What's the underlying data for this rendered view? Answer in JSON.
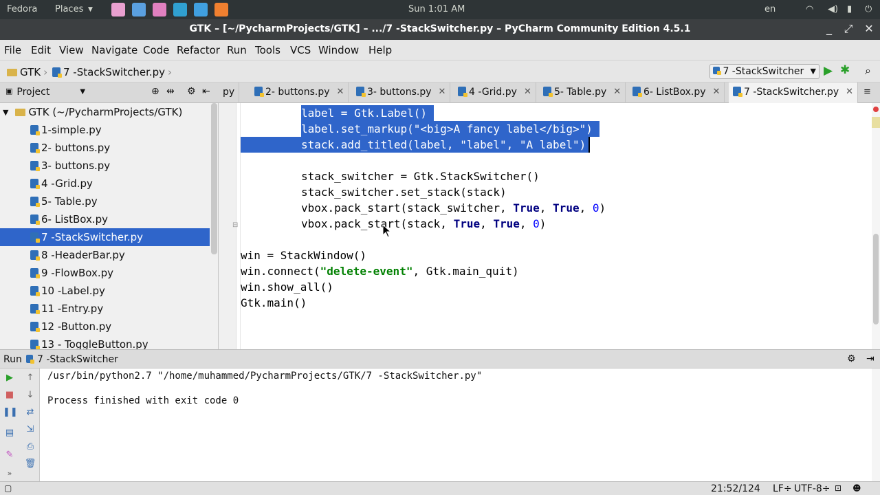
{
  "system": {
    "left": [
      "Fedora",
      "Places"
    ],
    "clock": "Sun 1:01 AM",
    "lang": "en"
  },
  "window": {
    "title": "GTK – [~/PycharmProjects/GTK] – .../7 -StackSwitcher.py – PyCharm Community Edition 4.5.1"
  },
  "menu": [
    "File",
    "Edit",
    "View",
    "Navigate",
    "Code",
    "Refactor",
    "Run",
    "Tools",
    "VCS",
    "Window",
    "Help"
  ],
  "breadcrumb": {
    "project": "GTK",
    "file": "7 -StackSwitcher.py"
  },
  "run_config": "7 -StackSwitcher",
  "project_panel": {
    "label": "Project"
  },
  "tabs": [
    {
      "label": "py"
    },
    {
      "label": "2- buttons.py"
    },
    {
      "label": "3- buttons.py"
    },
    {
      "label": "4 -Grid.py"
    },
    {
      "label": "5- Table.py"
    },
    {
      "label": "6- ListBox.py"
    },
    {
      "label": "7 -StackSwitcher.py"
    }
  ],
  "tree": {
    "root": "GTK (~/PycharmProjects/GTK)",
    "files": [
      "1-simple.py",
      "2- buttons.py",
      "3- buttons.py",
      "4 -Grid.py",
      "5- Table.py",
      "6- ListBox.py",
      "7 -StackSwitcher.py",
      "8 -HeaderBar.py",
      "9 -FlowBox.py",
      "10 -Label.py",
      "11 -Entry.py",
      "12 -Button.py",
      "13 - ToggleButton.py"
    ]
  },
  "code": [
    "        label = Gtk.Label()",
    "        label.set_markup(\"<big>A fancy label</big>\")",
    "        stack.add_titled(label, \"label\", \"A label\")",
    "",
    "        stack_switcher = Gtk.StackSwitcher()",
    "        stack_switcher.set_stack(stack)",
    "        vbox.pack_start(stack_switcher, True, True, 0)",
    "        vbox.pack_start(stack, True, True, 0)",
    "",
    "win = StackWindow()",
    "win.connect(\"delete-event\", Gtk.main_quit)",
    "win.show_all()",
    "Gtk.main()"
  ],
  "run": {
    "label": "Run",
    "config": "7 -StackSwitcher",
    "output": [
      "/usr/bin/python2.7 \"/home/muhammed/PycharmProjects/GTK/7 -StackSwitcher.py\"",
      "",
      "Process finished with exit code 0"
    ]
  },
  "status": {
    "position": "21:52/124",
    "line_sep": "LF÷",
    "encoding": "UTF-8÷"
  },
  "colors": {
    "selection": "#2f65ca",
    "string": "#008000",
    "number": "#0000ff"
  }
}
